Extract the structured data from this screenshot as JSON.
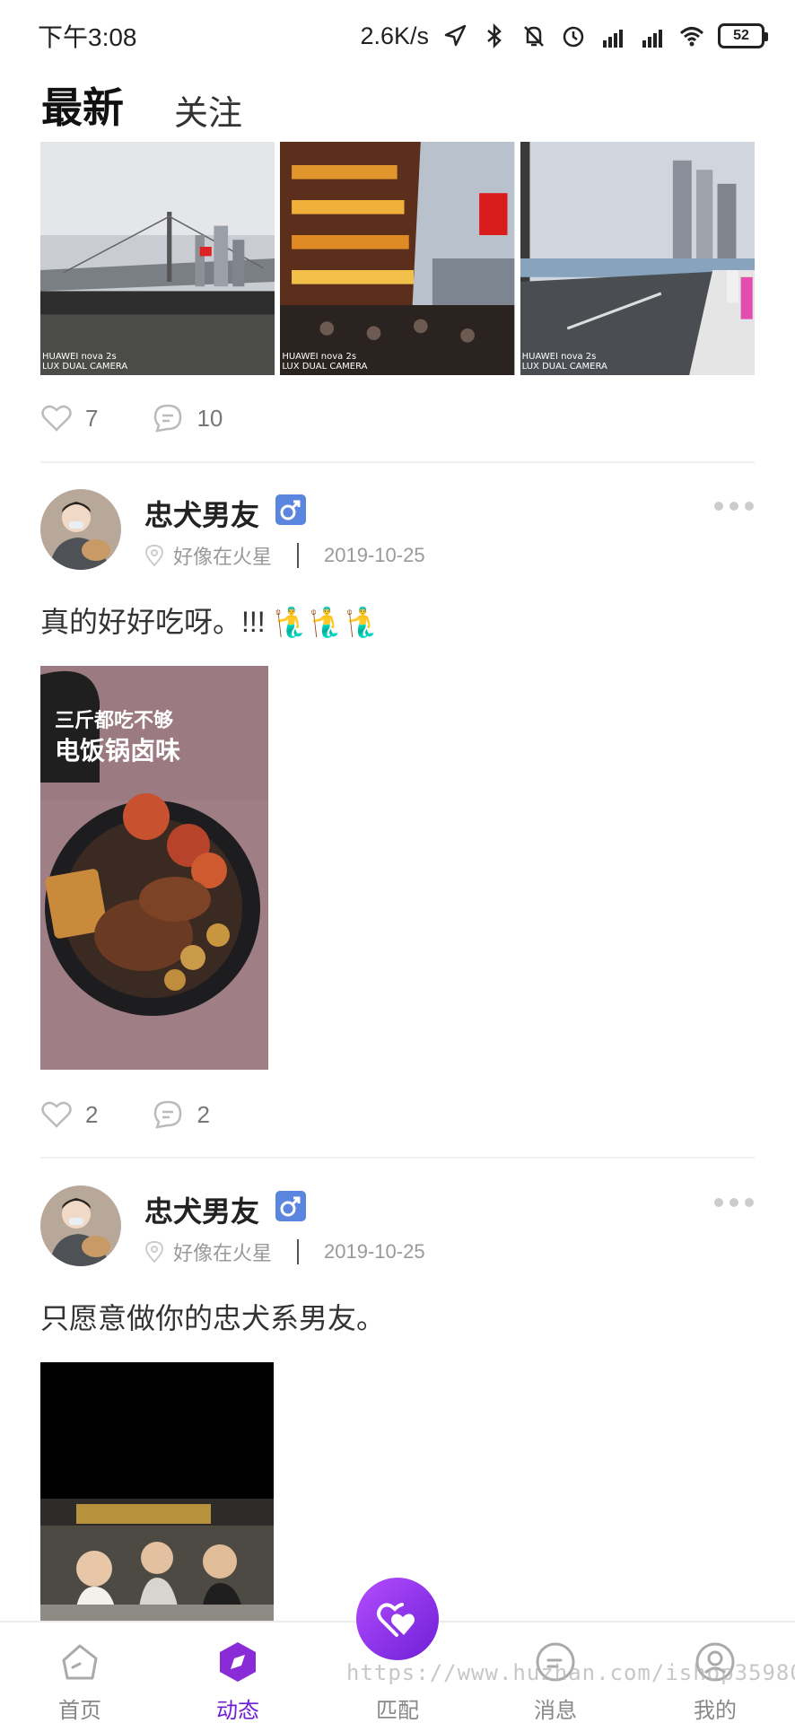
{
  "status_bar": {
    "time": "下午3:08",
    "net_speed": "2.6K/s",
    "battery": "52"
  },
  "tabs": [
    {
      "label": "最新",
      "active": true
    },
    {
      "label": "关注",
      "active": false
    }
  ],
  "accent_color": "#6e1fd6",
  "post0": {
    "photo_caption": "HUAWEI nova 2s\nLUX DUAL CAMERA",
    "likes": "7",
    "comments": "10"
  },
  "post1": {
    "username": "忠犬男友",
    "location": "好像在火星",
    "date": "2019-10-25",
    "text": "真的好好吃呀。!!! 🧜‍♂️🧜‍♂️🧜‍♂️",
    "image_line1": "三斤都吃不够",
    "image_line2": "电饭锅卤味",
    "likes": "2",
    "comments": "2"
  },
  "post2": {
    "username": "忠犬男友",
    "location": "好像在火星",
    "date": "2019-10-25",
    "text": "只愿意做你的忠犬系男友。"
  },
  "bottom_nav": [
    {
      "label": "首页",
      "icon": "home-icon",
      "active": false
    },
    {
      "label": "动态",
      "icon": "compass-icon",
      "active": true
    },
    {
      "label": "匹配",
      "icon": "heart-icon",
      "active": false
    },
    {
      "label": "消息",
      "icon": "message-icon",
      "active": false
    },
    {
      "label": "我的",
      "icon": "profile-icon",
      "active": false
    }
  ],
  "watermark": "https://www.huzhan.com/ishop35980"
}
